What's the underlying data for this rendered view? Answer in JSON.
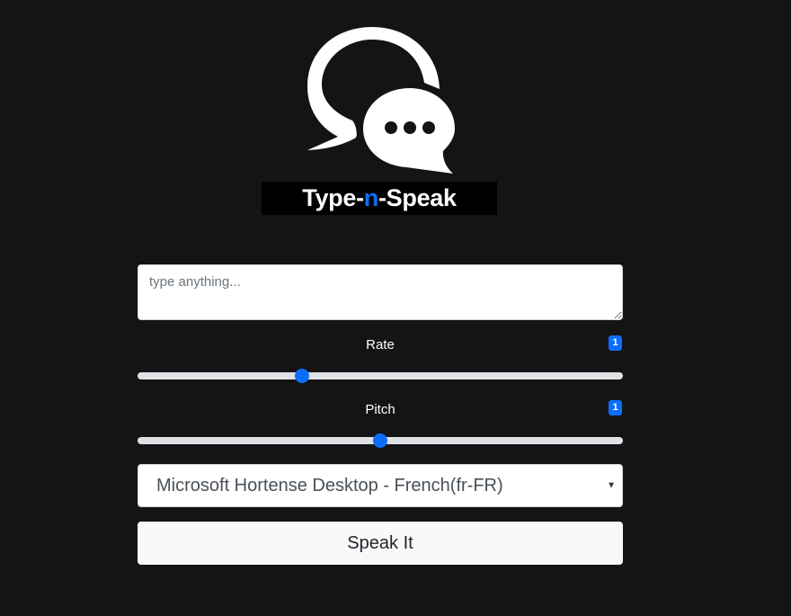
{
  "header": {
    "logo_icon": "chat-bubbles-icon",
    "title_prefix": "Type-",
    "title_accent": "n",
    "title_suffix": "-Speak",
    "accent_color": "#0d6efd"
  },
  "text_input": {
    "placeholder": "type anything...",
    "value": ""
  },
  "rate": {
    "label": "Rate",
    "badge": "1",
    "value": 1,
    "min": 0.5,
    "max": 2
  },
  "pitch": {
    "label": "Pitch",
    "badge": "1",
    "value": 1,
    "min": 0,
    "max": 2
  },
  "voice_select": {
    "selected": "Microsoft Hortense Desktop - French(fr-FR)"
  },
  "speak_button": {
    "label": "Speak It"
  },
  "colors": {
    "background": "#141414",
    "primary": "#0d6efd",
    "button_light": "#f8f9fa"
  }
}
